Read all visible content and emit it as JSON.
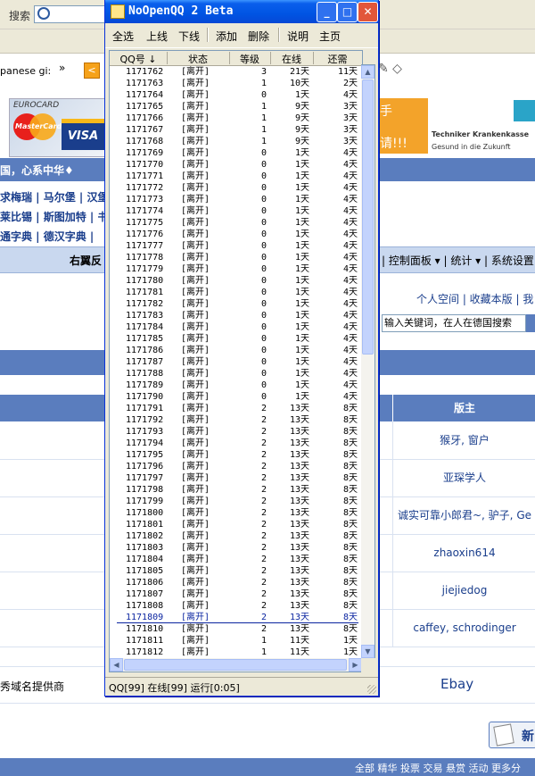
{
  "browser": {
    "search_label": "搜索",
    "tab_partial": "panese gi:",
    "chevron": "»",
    "back_glyph": "<",
    "tool_icons": "✎ ◇"
  },
  "page": {
    "ad_eurocard_title": "EUROCARD",
    "ad_mastercard_label": "MasterCard",
    "ad_visa_label": "VISA",
    "ad_orange_line1": "手",
    "ad_orange_line2": "请!!!",
    "ad_tk_title": "Techniker Krankenkasse",
    "ad_tk_sub": "Gesund in die Zukunft",
    "banner_text": "国，心系中华♦",
    "links_row1": "求梅瑞 | 马尔堡 | 汉堡",
    "links_row2": "莱比锡 | 斯图加特 | 书",
    "links_row3": "通字典 | 德汉字典 |",
    "nav_left": "右翼反",
    "nav_right": "| 控制面板 ▾ | 统计 ▾ | 系统设置",
    "user_links": "个人空间 | 收藏本版 | 我",
    "search_placeholder": "输入关键词，在人在德国搜索",
    "master_header": "版主",
    "forum_masters": [
      "猴牙, 窗户",
      "亚琛学人",
      "诚实可靠小郎君~, 驴子, Ge",
      "zhaoxin614",
      "jiejiedog",
      "caffey, schrodinger"
    ],
    "footer_left": "秀域名提供商",
    "footer_right": "Ebay",
    "new_button": "新",
    "bottom_links": "全部  精华  投票  交易  悬赏  活动  更多分"
  },
  "window": {
    "title": "NoOpenQQ 2 Beta",
    "minimize": "_",
    "maximize": "□",
    "close": "✕",
    "menu": [
      "全选",
      "上线",
      "下线",
      "添加",
      "删除",
      "说明",
      "主页"
    ],
    "columns": [
      "QQ号 ↓",
      "状态",
      "等级",
      "在线",
      "还需"
    ],
    "rows": [
      [
        "1171762",
        "[离开]",
        "3",
        "21天",
        "11天"
      ],
      [
        "1171763",
        "[离开]",
        "1",
        "10天",
        "2天"
      ],
      [
        "1171764",
        "[离开]",
        "0",
        "1天",
        "4天"
      ],
      [
        "1171765",
        "[离开]",
        "1",
        "9天",
        "3天"
      ],
      [
        "1171766",
        "[离开]",
        "1",
        "9天",
        "3天"
      ],
      [
        "1171767",
        "[离开]",
        "1",
        "9天",
        "3天"
      ],
      [
        "1171768",
        "[离开]",
        "1",
        "9天",
        "3天"
      ],
      [
        "1171769",
        "[离开]",
        "0",
        "1天",
        "4天"
      ],
      [
        "1171770",
        "[离开]",
        "0",
        "1天",
        "4天"
      ],
      [
        "1171771",
        "[离开]",
        "0",
        "1天",
        "4天"
      ],
      [
        "1171772",
        "[离开]",
        "0",
        "1天",
        "4天"
      ],
      [
        "1171773",
        "[离开]",
        "0",
        "1天",
        "4天"
      ],
      [
        "1171774",
        "[离开]",
        "0",
        "1天",
        "4天"
      ],
      [
        "1171775",
        "[离开]",
        "0",
        "1天",
        "4天"
      ],
      [
        "1171776",
        "[离开]",
        "0",
        "1天",
        "4天"
      ],
      [
        "1171777",
        "[离开]",
        "0",
        "1天",
        "4天"
      ],
      [
        "1171778",
        "[离开]",
        "0",
        "1天",
        "4天"
      ],
      [
        "1171779",
        "[离开]",
        "0",
        "1天",
        "4天"
      ],
      [
        "1171780",
        "[离开]",
        "0",
        "1天",
        "4天"
      ],
      [
        "1171781",
        "[离开]",
        "0",
        "1天",
        "4天"
      ],
      [
        "1171782",
        "[离开]",
        "0",
        "1天",
        "4天"
      ],
      [
        "1171783",
        "[离开]",
        "0",
        "1天",
        "4天"
      ],
      [
        "1171784",
        "[离开]",
        "0",
        "1天",
        "4天"
      ],
      [
        "1171785",
        "[离开]",
        "0",
        "1天",
        "4天"
      ],
      [
        "1171786",
        "[离开]",
        "0",
        "1天",
        "4天"
      ],
      [
        "1171787",
        "[离开]",
        "0",
        "1天",
        "4天"
      ],
      [
        "1171788",
        "[离开]",
        "0",
        "1天",
        "4天"
      ],
      [
        "1171789",
        "[离开]",
        "0",
        "1天",
        "4天"
      ],
      [
        "1171790",
        "[离开]",
        "0",
        "1天",
        "4天"
      ],
      [
        "1171791",
        "[离开]",
        "2",
        "13天",
        "8天"
      ],
      [
        "1171792",
        "[离开]",
        "2",
        "13天",
        "8天"
      ],
      [
        "1171793",
        "[离开]",
        "2",
        "13天",
        "8天"
      ],
      [
        "1171794",
        "[离开]",
        "2",
        "13天",
        "8天"
      ],
      [
        "1171795",
        "[离开]",
        "2",
        "13天",
        "8天"
      ],
      [
        "1171796",
        "[离开]",
        "2",
        "13天",
        "8天"
      ],
      [
        "1171797",
        "[离开]",
        "2",
        "13天",
        "8天"
      ],
      [
        "1171798",
        "[离开]",
        "2",
        "13天",
        "8天"
      ],
      [
        "1171799",
        "[离开]",
        "2",
        "13天",
        "8天"
      ],
      [
        "1171800",
        "[离开]",
        "2",
        "13天",
        "8天"
      ],
      [
        "1171801",
        "[离开]",
        "2",
        "13天",
        "8天"
      ],
      [
        "1171802",
        "[离开]",
        "2",
        "13天",
        "8天"
      ],
      [
        "1171803",
        "[离开]",
        "2",
        "13天",
        "8天"
      ],
      [
        "1171804",
        "[离开]",
        "2",
        "13天",
        "8天"
      ],
      [
        "1171805",
        "[离开]",
        "2",
        "13天",
        "8天"
      ],
      [
        "1171806",
        "[离开]",
        "2",
        "13天",
        "8天"
      ],
      [
        "1171807",
        "[离开]",
        "2",
        "13天",
        "8天"
      ],
      [
        "1171808",
        "[离开]",
        "2",
        "13天",
        "8天"
      ],
      [
        "1171809",
        "[离开]",
        "2",
        "13天",
        "8天"
      ],
      [
        "1171810",
        "[离开]",
        "2",
        "13天",
        "8天"
      ],
      [
        "1171811",
        "[离开]",
        "1",
        "11天",
        "1天"
      ],
      [
        "1171812",
        "[离开]",
        "1",
        "11天",
        "1天"
      ]
    ],
    "selected_qq": "1171809",
    "status": "QQ[99] 在线[99]  运行[0:05]"
  }
}
